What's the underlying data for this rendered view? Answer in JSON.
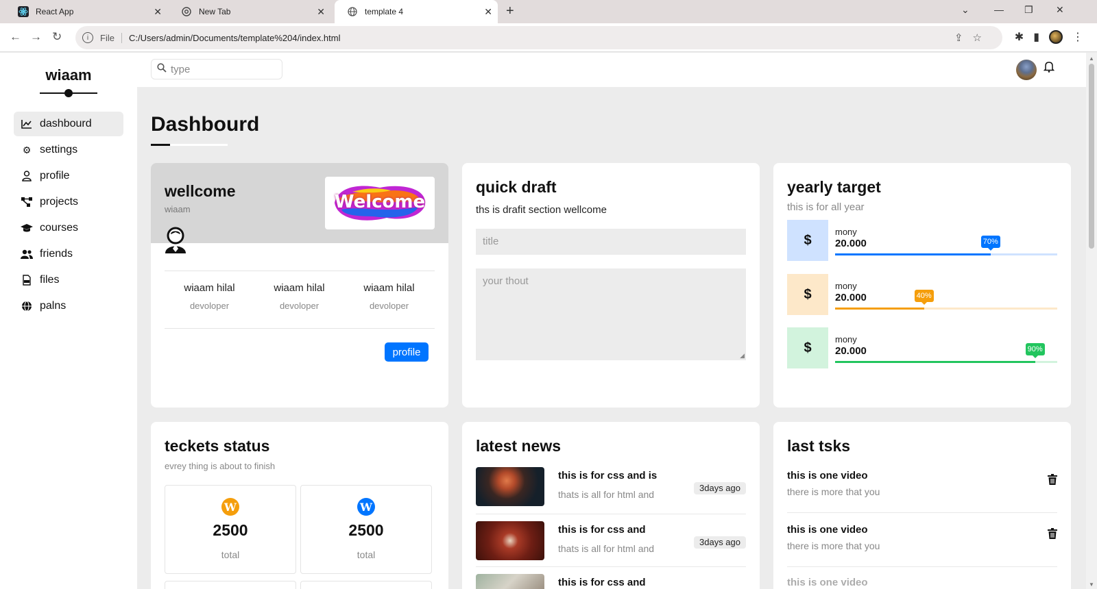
{
  "browser": {
    "tabs": [
      {
        "title": "React App",
        "active": false
      },
      {
        "title": "New Tab",
        "active": false
      },
      {
        "title": "template 4",
        "active": true
      }
    ],
    "address": {
      "scheme_label": "File",
      "url": "C:/Users/admin/Documents/template%204/index.html"
    }
  },
  "sidebar": {
    "brand": "wiaam",
    "items": [
      {
        "label": "dashbourd",
        "icon": "chart-line-icon",
        "active": true
      },
      {
        "label": "settings",
        "icon": "gear-icon",
        "active": false
      },
      {
        "label": "profile",
        "icon": "user-icon",
        "active": false
      },
      {
        "label": "projects",
        "icon": "diagram-icon",
        "active": false
      },
      {
        "label": "courses",
        "icon": "graduation-cap-icon",
        "active": false
      },
      {
        "label": "friends",
        "icon": "users-icon",
        "active": false
      },
      {
        "label": "files",
        "icon": "file-pdf-icon",
        "active": false
      },
      {
        "label": "palns",
        "icon": "globe-icon",
        "active": false
      }
    ]
  },
  "topbar": {
    "search_placeholder": "type"
  },
  "page": {
    "title": "Dashbourd"
  },
  "welcome": {
    "title": "wellcome",
    "subtitle": "wiaam",
    "image_text": "Welcome",
    "members": [
      {
        "name": "wiaam hilal",
        "role": "devoloper"
      },
      {
        "name": "wiaam hilal",
        "role": "devoloper"
      },
      {
        "name": "wiaam hilal",
        "role": "devoloper"
      }
    ],
    "button": "profile"
  },
  "draft": {
    "title": "quick draft",
    "subtitle": "ths is drafit section wellcome",
    "title_placeholder": "title",
    "body_placeholder": "your thout"
  },
  "target": {
    "title": "yearly target",
    "subtitle": "this is for all year",
    "rows": [
      {
        "symbol": "$",
        "label": "mony",
        "value": "20.000",
        "percent": 70,
        "percent_label": "70%",
        "color": "#0075ff",
        "bg": "#cfe2ff",
        "track": "#cfe2ff"
      },
      {
        "symbol": "$",
        "label": "mony",
        "value": "20.000",
        "percent": 40,
        "percent_label": "40%",
        "color": "#f59e0b",
        "bg": "#fde8c9",
        "track": "#fde8c9"
      },
      {
        "symbol": "$",
        "label": "mony",
        "value": "20.000",
        "percent": 90,
        "percent_label": "90%",
        "color": "#22c55e",
        "bg": "#d2f3dd",
        "track": "#d2f3dd"
      }
    ]
  },
  "tickets": {
    "title": "teckets status",
    "subtitle": "evrey thing is about to finish",
    "boxes": [
      {
        "icon": "wordpress-icon",
        "color": "#f59e0b",
        "number": "2500",
        "label": "total"
      },
      {
        "icon": "wordpress-icon",
        "color": "#0075ff",
        "number": "2500",
        "label": "total"
      }
    ]
  },
  "news": {
    "title": "latest news",
    "items": [
      {
        "title": "this is for css and is",
        "desc": "thats is all for html and",
        "badge": "3days ago"
      },
      {
        "title": "this is for css and",
        "desc": "thats is all for html and",
        "badge": "3days ago"
      },
      {
        "title": "this is for css and",
        "desc": "",
        "badge": ""
      }
    ]
  },
  "tasks": {
    "title": "last tsks",
    "items": [
      {
        "title": "this is one video",
        "desc": "there is more that you"
      },
      {
        "title": "this is one video",
        "desc": "there is more that you"
      },
      {
        "title": "this is one video",
        "desc": ""
      }
    ]
  }
}
